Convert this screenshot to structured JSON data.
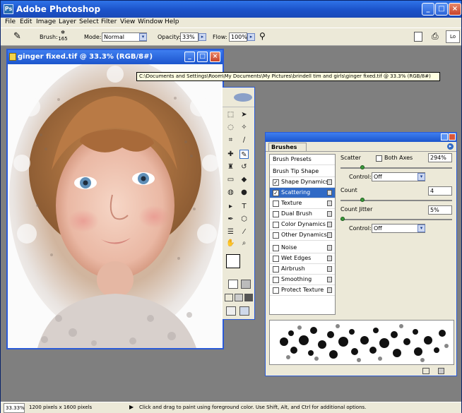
{
  "app": {
    "title": "Adobe Photoshop",
    "logo": "Ps"
  },
  "window_controls": {
    "minimize": "_",
    "maximize": "□",
    "close": "×"
  },
  "menu": [
    "File",
    "Edit",
    "Image",
    "Layer",
    "Select",
    "Filter",
    "View",
    "Window",
    "Help"
  ],
  "options": {
    "brush_label": "Brush:",
    "brush_size": "165",
    "mode_label": "Mode:",
    "mode_value": "Normal",
    "opacity_label": "Opacity:",
    "opacity_value": "33%",
    "flow_label": "Flow:",
    "flow_value": "100%"
  },
  "document": {
    "title": "ginger fixed.tif @ 33.3% (RGB/8#)",
    "tooltip": "C:\\Documents and Settings\\Room\\My Documents\\My Pictures\\brindell tim and girls\\ginger fixed.tif @ 33.3% (RGB/8#)"
  },
  "brushes": {
    "tab": "Brushes",
    "list": [
      {
        "label": "Brush Presets",
        "check": false,
        "lock": false,
        "type": "header"
      },
      {
        "label": "Brush Tip Shape",
        "check": false,
        "lock": false,
        "type": "header"
      },
      {
        "label": "Shape Dynamics",
        "check": true,
        "lock": true,
        "type": "item"
      },
      {
        "label": "Scattering",
        "check": true,
        "lock": true,
        "type": "item",
        "selected": true
      },
      {
        "label": "Texture",
        "check": false,
        "lock": true,
        "type": "item"
      },
      {
        "label": "Dual Brush",
        "check": false,
        "lock": true,
        "type": "item"
      },
      {
        "label": "Color Dynamics",
        "check": false,
        "lock": true,
        "type": "item"
      },
      {
        "label": "Other Dynamics",
        "check": false,
        "lock": true,
        "type": "item"
      },
      {
        "label": "Noise",
        "check": false,
        "lock": true,
        "type": "item"
      },
      {
        "label": "Wet Edges",
        "check": false,
        "lock": true,
        "type": "item"
      },
      {
        "label": "Airbrush",
        "check": false,
        "lock": true,
        "type": "item"
      },
      {
        "label": "Smoothing",
        "check": false,
        "lock": true,
        "type": "item"
      },
      {
        "label": "Protect Texture",
        "check": false,
        "lock": true,
        "type": "item"
      }
    ],
    "scatter_label": "Scatter",
    "both_axes_label": "Both Axes",
    "scatter_value": "294%",
    "control_label": "Control:",
    "control_value": "Off",
    "count_label": "Count",
    "count_value": "4",
    "count_jitter_label": "Count Jitter",
    "count_jitter_value": "5%",
    "control2_label": "Control:",
    "control2_value": "Off"
  },
  "status": {
    "zoom": "33.33%",
    "size": "1200 pixels x 1600 pixels",
    "hint": "Click and drag to paint using foreground color. Use Shift, Alt, and Ctrl for additional options."
  }
}
